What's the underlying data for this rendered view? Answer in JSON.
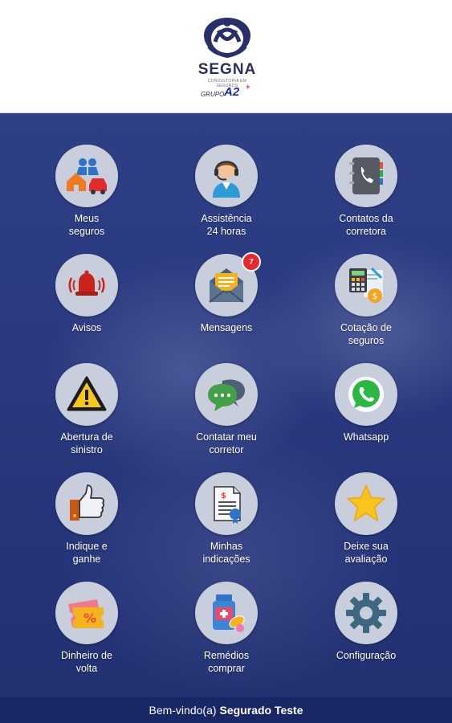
{
  "brand": {
    "name": "SEGNA",
    "subtitle": "CONSULTORIA EM SEGUROS",
    "group_prefix": "GRUPO",
    "group_mark": "A2",
    "group_sup": "+"
  },
  "menu": [
    {
      "label": "Meus\nseguros",
      "icon": "family-insurance-icon"
    },
    {
      "label": "Assistência\n24 horas",
      "icon": "headset-agent-icon"
    },
    {
      "label": "Contatos da\ncorretora",
      "icon": "phonebook-icon"
    },
    {
      "label": "Avisos",
      "icon": "alarm-bell-icon"
    },
    {
      "label": "Mensagens",
      "icon": "envelope-icon",
      "badge": "7"
    },
    {
      "label": "Cotação de\nseguros",
      "icon": "calculator-quote-icon"
    },
    {
      "label": "Abertura de\nsinistro",
      "icon": "warning-sign-icon"
    },
    {
      "label": "Contatar meu\ncorretor",
      "icon": "chat-bubbles-icon"
    },
    {
      "label": "Whatsapp",
      "icon": "whatsapp-icon"
    },
    {
      "label": "Indique e\nganhe",
      "icon": "thumbs-up-icon"
    },
    {
      "label": "Minhas\nindicações",
      "icon": "invoice-document-icon"
    },
    {
      "label": "Deixe sua\navaliação",
      "icon": "star-icon"
    },
    {
      "label": "Dinheiro de\nvolta",
      "icon": "discount-ticket-icon"
    },
    {
      "label": "Remédios\ncomprar",
      "icon": "medicine-pills-icon"
    },
    {
      "label": "Configuração",
      "icon": "gear-icon"
    }
  ],
  "footer": {
    "greeting": "Bem-vindo(a)",
    "user": "Segurado Teste"
  },
  "colors": {
    "header_bg": "#ffffff",
    "main_bg": "#2b3a80",
    "footer_bg": "#1a2766",
    "circle_bg": "#c9cedd",
    "badge": "#e8262b"
  }
}
